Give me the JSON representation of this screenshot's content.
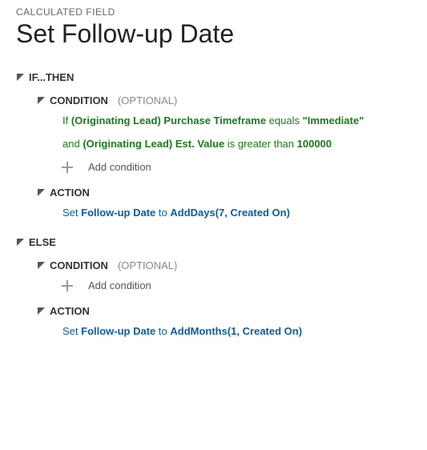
{
  "overline": "CALCULATED FIELD",
  "title": "Set Follow-up Date",
  "ifthen": {
    "label": "IF...THEN",
    "condition": {
      "label": "CONDITION",
      "suffix": "(OPTIONAL)",
      "line1": {
        "p1": "If ",
        "p2": "(Originating Lead) Purchase Timeframe",
        "p3": " equals ",
        "p4": "\"Immediate\""
      },
      "line2": {
        "p1": "and ",
        "p2": "(Originating Lead) Est. Value",
        "p3": " is greater than ",
        "p4": "100000"
      },
      "add": "Add condition"
    },
    "action": {
      "label": "ACTION",
      "line": {
        "p1": "Set ",
        "p2": "Follow-up Date",
        "p3": " to ",
        "p4": "AddDays(7, Created On)"
      }
    }
  },
  "else": {
    "label": "ELSE",
    "condition": {
      "label": "CONDITION",
      "suffix": "(OPTIONAL)",
      "add": "Add condition"
    },
    "action": {
      "label": "ACTION",
      "line": {
        "p1": "Set ",
        "p2": "Follow-up Date",
        "p3": " to ",
        "p4": "AddMonths(1, Created On)"
      }
    }
  }
}
